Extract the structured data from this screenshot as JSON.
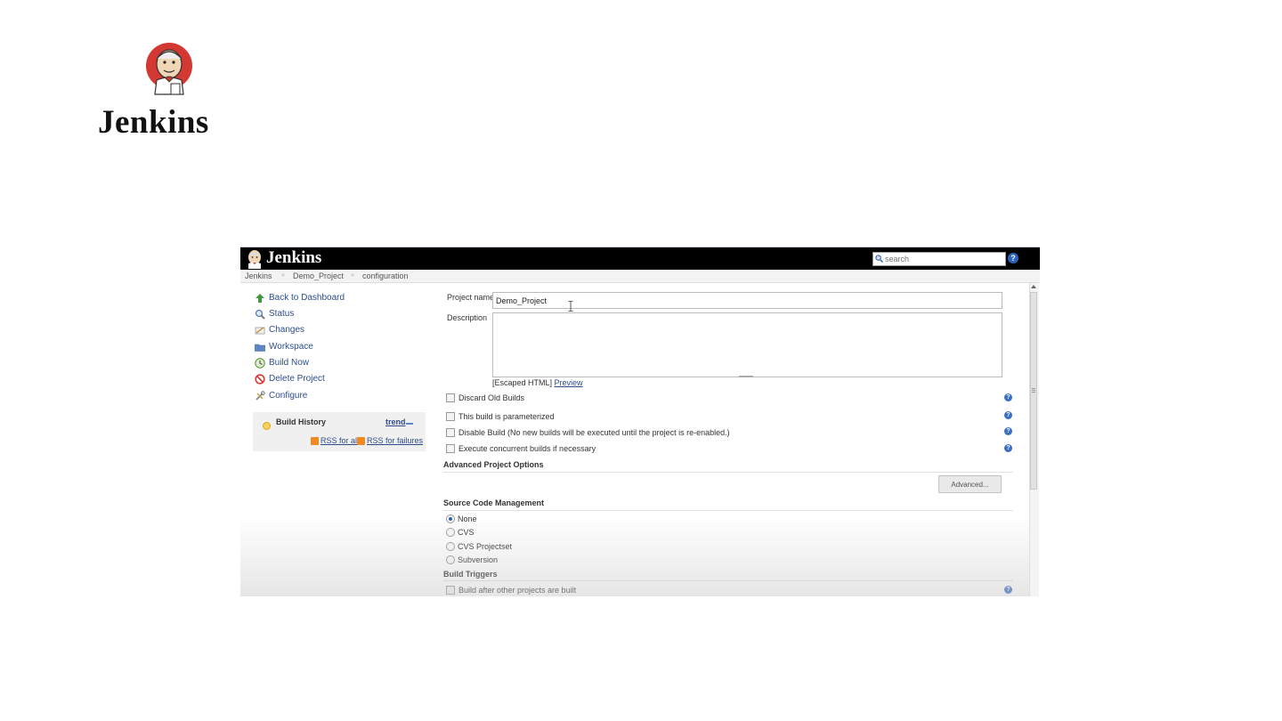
{
  "slide": {
    "logo_word": "Jenkins"
  },
  "header": {
    "title": "Jenkins",
    "search_placeholder": "search",
    "help_glyph": "?"
  },
  "breadcrumb": [
    "Jenkins",
    "Demo_Project",
    "configuration"
  ],
  "sidebar": {
    "items": [
      {
        "label": "Back to Dashboard",
        "icon": "up-arrow-icon"
      },
      {
        "label": "Status",
        "icon": "magnifier-icon"
      },
      {
        "label": "Changes",
        "icon": "notepad-icon"
      },
      {
        "label": "Workspace",
        "icon": "folder-icon"
      },
      {
        "label": "Build Now",
        "icon": "clock-icon"
      },
      {
        "label": "Delete Project",
        "icon": "no-entry-icon"
      },
      {
        "label": "Configure",
        "icon": "wrench-icon"
      }
    ],
    "build_history": {
      "title": "Build History",
      "trend": "trend",
      "rss_all": "RSS for all",
      "rss_failures": "RSS for failures"
    }
  },
  "form": {
    "project_name_label": "Project name",
    "project_name_value": "Demo_Project",
    "description_label": "Description",
    "description_value": "",
    "escaped_html": "[Escaped HTML]",
    "preview": "Preview",
    "options": [
      {
        "label": "Discard Old Builds",
        "checked": false
      },
      {
        "label": "This build is parameterized",
        "checked": false
      },
      {
        "label": "Disable Build (No new builds will be executed until the project is re-enabled.)",
        "checked": false
      },
      {
        "label": "Execute concurrent builds if necessary",
        "checked": false
      }
    ],
    "advanced_project_options": "Advanced Project Options",
    "advanced_button": "Advanced...",
    "scm": {
      "title": "Source Code Management",
      "options": [
        "None",
        "CVS",
        "CVS Projectset",
        "Subversion"
      ],
      "selected": "None"
    },
    "build_triggers": {
      "title": "Build Triggers",
      "options": [
        {
          "label": "Build after other projects are built",
          "checked": false
        }
      ]
    }
  }
}
